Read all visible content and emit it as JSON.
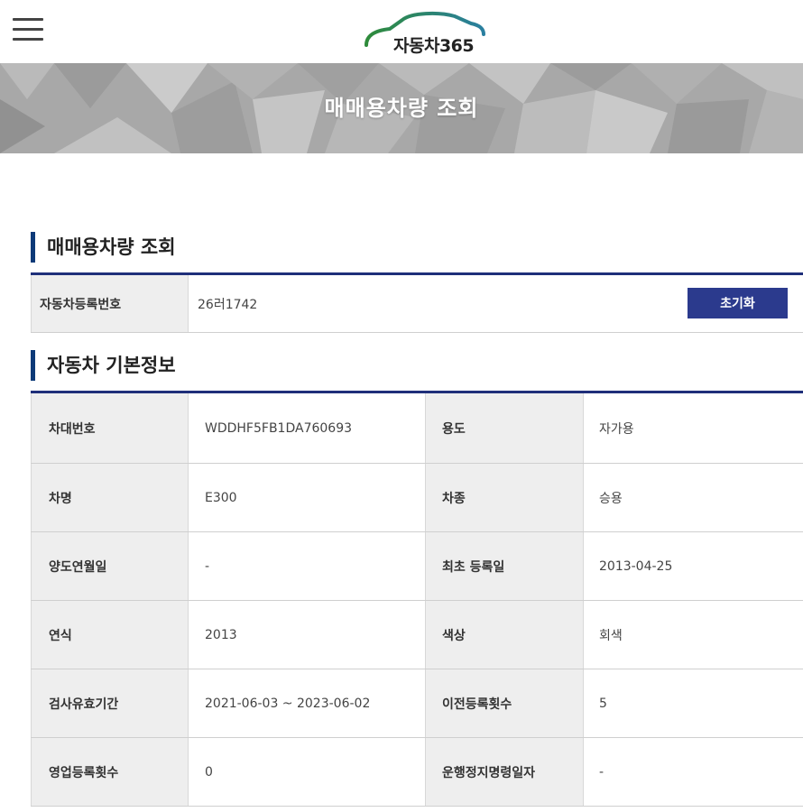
{
  "header": {
    "logo_text": "자동차365",
    "menu_icon": "hamburger-menu-icon"
  },
  "banner": {
    "title": "매매용차량 조회"
  },
  "search_section": {
    "title": "매매용차량 조회",
    "field_label": "자동차등록번호",
    "field_value": "26러1742",
    "reset_label": "초기화"
  },
  "info_section": {
    "title": "자동차 기본정보",
    "rows": [
      {
        "l1": "차대번호",
        "v1": "WDDHF5FB1DA760693",
        "l2": "용도",
        "v2": "자가용"
      },
      {
        "l1": "차명",
        "v1": "E300",
        "l2": "차종",
        "v2": "승용"
      },
      {
        "l1": "양도연월일",
        "v1": "-",
        "l2": "최초 등록일",
        "v2": "2013-04-25"
      },
      {
        "l1": "연식",
        "v1": "2013",
        "l2": "색상",
        "v2": "회색"
      },
      {
        "l1": "검사유효기간",
        "v1": "2021-06-03 ~ 2023-06-02",
        "l2": "이전등록횟수",
        "v2": "5"
      },
      {
        "l1": "영업등록횟수",
        "v1": "0",
        "l2": "운행정지명령일자",
        "v2": "-"
      }
    ]
  },
  "colors": {
    "accent": "#2b3a8d",
    "section_bar": "#0d3a78",
    "table_border": "#1f2f7a",
    "header_cell_bg": "#eeeeee"
  }
}
